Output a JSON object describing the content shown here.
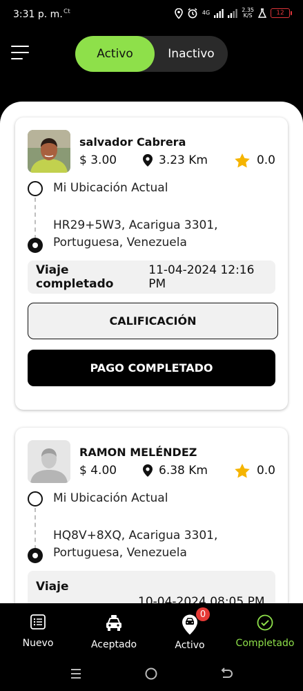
{
  "status_bar": {
    "time": "3:31 p. m.",
    "carrier_icon": "Ct",
    "network": "4G",
    "speed_value": "2.35",
    "speed_unit": "K/S",
    "battery": "12"
  },
  "header": {
    "menu_icon": "hamburger-menu-icon",
    "toggle": {
      "active_label": "Activo",
      "inactive_label": "Inactivo"
    }
  },
  "rides": [
    {
      "name": "salvador Cabrera",
      "fare": "$ 3.00",
      "distance": "3.23 Km",
      "rating": "0.0",
      "origin": "Mi Ubicación Actual",
      "destination_line1": "HR29+5W3, Acarigua 3301,",
      "destination_line2": "Portuguesa, Venezuela",
      "status_label": "Viaje completado",
      "status_date": "11-04-2024 12:16 PM",
      "rating_button": "CALIFICACIÓN",
      "payment_button": "PAGO COMPLETADO"
    },
    {
      "name": "RAMON MELÉNDEZ",
      "fare": "$ 4.00",
      "distance": "6.38 Km",
      "rating": "0.0",
      "origin": "Mi Ubicación Actual",
      "destination_line1": "HQ8V+8XQ, Acarigua 3301,",
      "destination_line2": "Portuguesa, Venezuela",
      "status_label": "Viaje",
      "status_date": "10-04-2024 08:05 PM"
    }
  ],
  "bottom_nav": {
    "items": [
      {
        "label": "Nuevo",
        "icon": "list-icon"
      },
      {
        "label": "Aceptado",
        "icon": "taxi-icon"
      },
      {
        "label": "Activo",
        "icon": "car-pin-icon",
        "badge": "0"
      },
      {
        "label": "Completado",
        "icon": "check-circle-icon"
      }
    ]
  },
  "colors": {
    "accent": "#8ee04a",
    "badge": "#e53935",
    "star": "#f5b400",
    "battery": "#e0353a"
  }
}
